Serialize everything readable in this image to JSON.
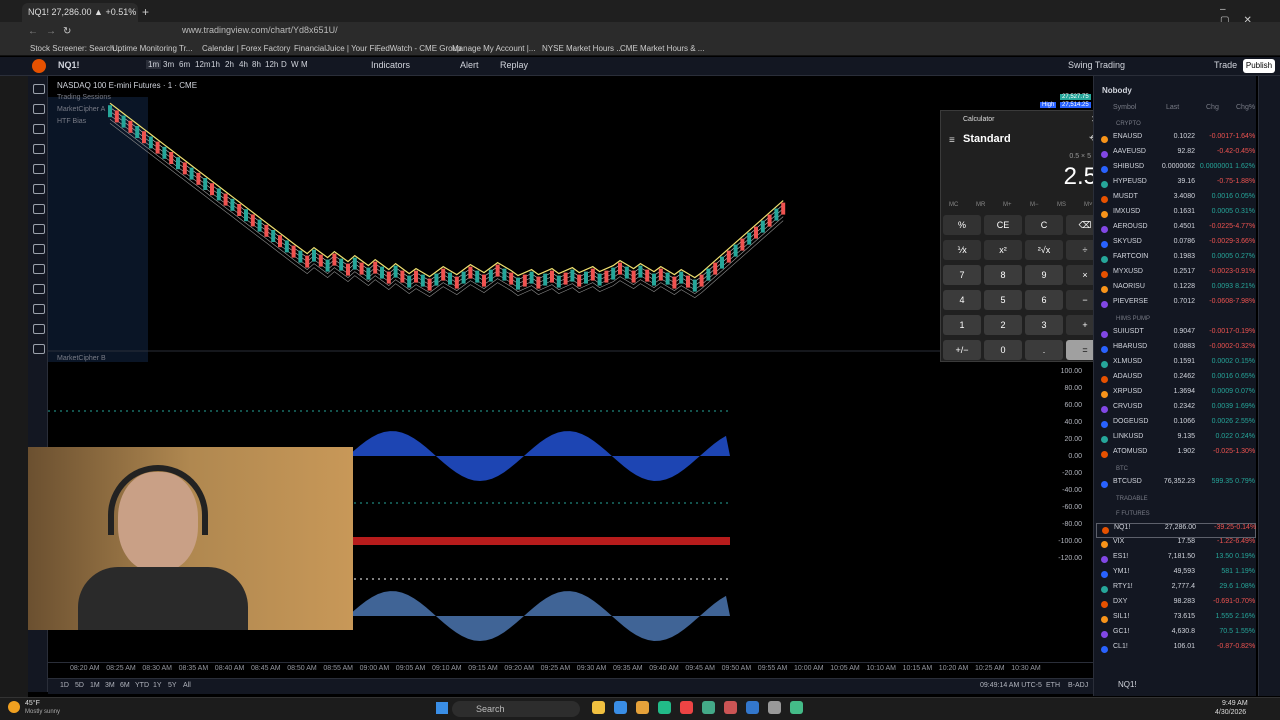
{
  "browser": {
    "tab_title": "NQ1! 27,286.00 ▲ +0.51% Swin",
    "url": "www.tradingview.com/chart/Yd8x651U/",
    "bookmarks": [
      "Stock Screener: Search...",
      "Uptime Monitoring Tr...",
      "Calendar | Forex Factory",
      "FinancialJuice | Your Fi...",
      "FedWatch - CME Group",
      "Manage My Account |...",
      "NYSE Market Hours ...",
      "CME Market Hours & ..."
    ]
  },
  "toolbar": {
    "symbol": "NQ1!",
    "intervals": [
      "1m",
      "3m",
      "6m",
      "12m",
      "1h",
      "2h",
      "4h",
      "8h",
      "12h",
      "D",
      "W",
      "M"
    ],
    "indicators": "Indicators",
    "alert": "Alert",
    "replay": "Replay",
    "layout_name": "Swing Trading",
    "trade": "Trade",
    "publish": "Publish"
  },
  "chart": {
    "title": "NASDAQ 100 E-mini Futures · 1 · CME",
    "legend": [
      "Trading Sessions",
      "MarketCipher A",
      "HTF Bias"
    ],
    "pane2_title": "MarketCipher B",
    "high_label": "High",
    "high_value": "27,514.25",
    "current_value": "27,527.75",
    "osc_ticks": [
      "100.00",
      "80.00",
      "60.00",
      "40.00",
      "20.00",
      "0.00",
      "-20.00",
      "-40.00",
      "-60.00",
      "-80.00",
      "-100.00",
      "-120.00"
    ],
    "time_ticks": [
      "08:20 AM",
      "08:25 AM",
      "08:30 AM",
      "08:35 AM",
      "08:40 AM",
      "08:45 AM",
      "08:50 AM",
      "08:55 AM",
      "09:00 AM",
      "09:05 AM",
      "09:10 AM",
      "09:15 AM",
      "09:20 AM",
      "09:25 AM",
      "09:30 AM",
      "09:35 AM",
      "09:40 AM",
      "09:45 AM",
      "09:50 AM",
      "09:55 AM",
      "10:00 AM",
      "10:05 AM",
      "10:10 AM",
      "10:15 AM",
      "10:20 AM",
      "10:25 AM",
      "10:30 AM"
    ],
    "ranges": [
      "1D",
      "5D",
      "1M",
      "3M",
      "6M",
      "YTD",
      "1Y",
      "5Y",
      "All"
    ],
    "clock": "09:49:14 AM UTC-5",
    "session": "ETH",
    "adj": "B-ADJ"
  },
  "calculator": {
    "window_title": "Calculator",
    "mode": "Standard",
    "expression": "0.5 × 5 =",
    "display": "2.5",
    "memory": [
      "MC",
      "MR",
      "M+",
      "M−",
      "MS",
      "M˅"
    ],
    "keys": [
      "%",
      "CE",
      "C",
      "⌫",
      "⅟x",
      "x²",
      "²√x",
      "÷",
      "7",
      "8",
      "9",
      "×",
      "4",
      "5",
      "6",
      "−",
      "1",
      "2",
      "3",
      "+",
      "+/−",
      "0",
      ".",
      "="
    ]
  },
  "watchlist": {
    "name": "Nobody",
    "headers": [
      "Symbol",
      "Last",
      "Chg",
      "Chg%"
    ],
    "sections": [
      {
        "title": "CRYPTO",
        "rows": [
          [
            "ENAUSD",
            "0.1022",
            "-0.0017",
            "-1.64%",
            "red"
          ],
          [
            "AAVEUSD",
            "92.82",
            "-0.42",
            "-0.45%",
            "red"
          ],
          [
            "SHIBUSD",
            "0.0000062",
            "0.0000001",
            "1.62%",
            "green"
          ],
          [
            "HYPEUSD",
            "39.16",
            "-0.75",
            "-1.88%",
            "red"
          ],
          [
            "MUSDT",
            "3.4080",
            "0.0016",
            "0.05%",
            "green"
          ],
          [
            "IMXUSD",
            "0.1631",
            "0.0005",
            "0.31%",
            "green"
          ],
          [
            "AEROUSD",
            "0.4501",
            "-0.0225",
            "-4.77%",
            "red"
          ],
          [
            "SKYUSD",
            "0.0786",
            "-0.0029",
            "-3.66%",
            "red"
          ],
          [
            "FARTCOIN",
            "0.1983",
            "0.0005",
            "0.27%",
            "green"
          ],
          [
            "MYXUSD",
            "0.2517",
            "-0.0023",
            "-0.91%",
            "red"
          ],
          [
            "NAORISU",
            "0.1228",
            "0.0093",
            "8.21%",
            "green"
          ],
          [
            "PIEVERSE",
            "0.7012",
            "-0.0608",
            "-7.98%",
            "red"
          ]
        ]
      },
      {
        "title": "HIMS PUMP",
        "rows": [
          [
            "SUIUSDT",
            "0.9047",
            "-0.0017",
            "-0.19%",
            "red"
          ],
          [
            "HBARUSD",
            "0.0883",
            "-0.0002",
            "-0.32%",
            "red"
          ],
          [
            "XLMUSD",
            "0.1591",
            "0.0002",
            "0.15%",
            "green"
          ],
          [
            "ADAUSD",
            "0.2462",
            "0.0016",
            "0.65%",
            "green"
          ],
          [
            "XRPUSD",
            "1.3694",
            "0.0009",
            "0.07%",
            "green"
          ],
          [
            "CRVUSD",
            "0.2342",
            "0.0039",
            "1.69%",
            "green"
          ],
          [
            "DOGEUSD",
            "0.1066",
            "0.0026",
            "2.55%",
            "green"
          ],
          [
            "LINKUSD",
            "9.135",
            "0.022",
            "0.24%",
            "green"
          ],
          [
            "ATOMUSD",
            "1.902",
            "-0.025",
            "-1.30%",
            "red"
          ]
        ]
      },
      {
        "title": "BTC",
        "rows": [
          [
            "BTCUSD",
            "76,352.23",
            "599.35",
            "0.79%",
            "green"
          ]
        ]
      },
      {
        "title": "TRADABLE",
        "rows": []
      },
      {
        "title": "F FUTURES",
        "rows": [
          [
            "NQ1!",
            "27,286.00",
            "-39.25",
            "-0.14%",
            "red"
          ],
          [
            "VIX",
            "17.58",
            "-1.22",
            "-6.49%",
            "red"
          ],
          [
            "ES1!",
            "7,181.50",
            "13.50",
            "0.19%",
            "green"
          ],
          [
            "YM1!",
            "49,593",
            "581",
            "1.19%",
            "green"
          ],
          [
            "RTY1!",
            "2,777.4",
            "29.6",
            "1.08%",
            "green"
          ],
          [
            "DXY",
            "98.283",
            "-0.691",
            "-0.70%",
            "red"
          ],
          [
            "SIL1!",
            "73.615",
            "1.555",
            "2.16%",
            "green"
          ],
          [
            "GC1!",
            "4,630.8",
            "70.5",
            "1.55%",
            "green"
          ],
          [
            "CL1!",
            "106.01",
            "-0.87",
            "-0.82%",
            "red"
          ]
        ]
      }
    ],
    "footer_symbol": "NQ1!"
  },
  "taskbar": {
    "weather_temp": "45°F",
    "weather_desc": "Mostly sunny",
    "search": "Search",
    "time": "9:49 AM",
    "date": "4/30/2026"
  },
  "colors": {
    "up": "#26a69a",
    "down": "#ef5350",
    "accent": "#2962ff"
  }
}
